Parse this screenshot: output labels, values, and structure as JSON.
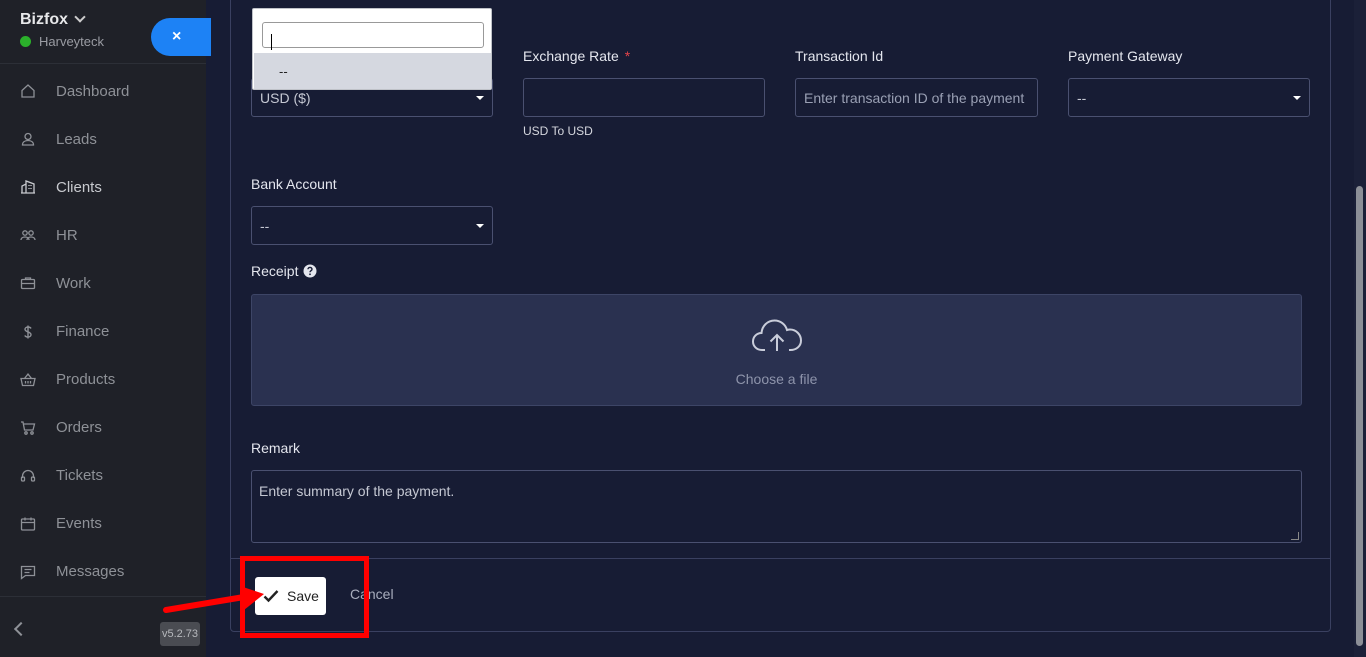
{
  "sidebar": {
    "brand": "Bizfox",
    "user": "Harveyteck",
    "close_glyph": "×",
    "items": [
      {
        "label": "Dashboard",
        "icon": "home-icon"
      },
      {
        "label": "Leads",
        "icon": "user-icon"
      },
      {
        "label": "Clients",
        "icon": "building-icon"
      },
      {
        "label": "HR",
        "icon": "users-icon"
      },
      {
        "label": "Work",
        "icon": "briefcase-icon"
      },
      {
        "label": "Finance",
        "icon": "dollar-icon"
      },
      {
        "label": "Products",
        "icon": "basket-icon"
      },
      {
        "label": "Orders",
        "icon": "cart-icon"
      },
      {
        "label": "Tickets",
        "icon": "headset-icon"
      },
      {
        "label": "Events",
        "icon": "calendar-icon"
      },
      {
        "label": "Messages",
        "icon": "message-icon"
      }
    ],
    "version": "v5.2.73"
  },
  "form": {
    "currency": {
      "value": "USD ($)"
    },
    "exchange_rate": {
      "label": "Exchange Rate",
      "required": "*",
      "value": "",
      "hint": "USD To USD"
    },
    "transaction_id": {
      "label": "Transaction Id",
      "placeholder": "Enter transaction ID of the payment"
    },
    "payment_gateway": {
      "label": "Payment Gateway",
      "value": "--"
    },
    "bank_account": {
      "label": "Bank Account",
      "value": "--"
    },
    "receipt": {
      "label": "Receipt",
      "dropzone_text": "Choose a file"
    },
    "remark": {
      "label": "Remark",
      "placeholder": "Enter summary of the payment."
    }
  },
  "dropdown": {
    "search_value": "",
    "options": [
      "--"
    ]
  },
  "footer": {
    "save_label": "Save",
    "cancel_label": "Cancel"
  },
  "colors": {
    "accent": "#1d82f5",
    "annotation": "#ff0000",
    "panel_bg": "#171c34",
    "sidebar_bg": "#1f2128"
  }
}
